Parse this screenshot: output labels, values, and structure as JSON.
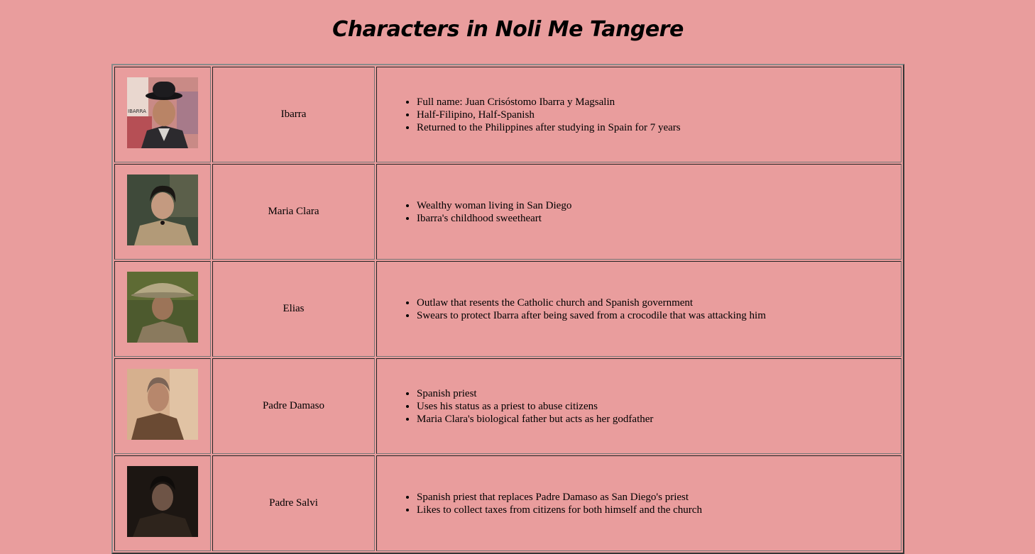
{
  "page": {
    "title": "Characters in Noli Me Tangere"
  },
  "colors": {
    "background": "#e99d9d",
    "border": "#777777"
  },
  "characters": [
    {
      "name": "Ibarra",
      "photo_icon": "ibarra-portrait-icon",
      "photo_text": "IBARRA",
      "details": [
        "Full name: Juan Crisóstomo Ibarra y Magsalin",
        "Half-Filipino, Half-Spanish",
        "Returned to the Philippines after studying in Spain for 7 years"
      ]
    },
    {
      "name": "Maria Clara",
      "photo_icon": "maria-clara-portrait-icon",
      "details": [
        "Wealthy woman living in San Diego",
        "Ibarra's childhood sweetheart"
      ]
    },
    {
      "name": "Elias",
      "photo_icon": "elias-portrait-icon",
      "details": [
        "Outlaw that resents the Catholic church and Spanish government",
        "Swears to protect Ibarra after being saved from a crocodile that was attacking him"
      ]
    },
    {
      "name": "Padre Damaso",
      "photo_icon": "padre-damaso-portrait-icon",
      "details": [
        "Spanish priest",
        "Uses his status as a priest to abuse citizens",
        "Maria Clara's biological father but acts as her godfather"
      ]
    },
    {
      "name": "Padre Salvi",
      "photo_icon": "padre-salvi-portrait-icon",
      "details": [
        "Spanish priest that replaces Padre Damaso as San Diego's priest",
        "Likes to collect taxes from citizens for both himself and the church"
      ]
    }
  ]
}
